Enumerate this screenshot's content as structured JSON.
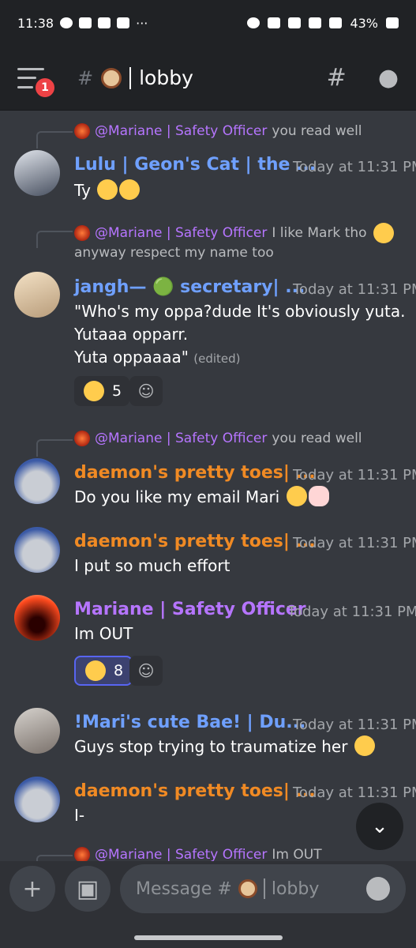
{
  "statusbar": {
    "time": "11:38",
    "dots": "···",
    "battery": "43%"
  },
  "header": {
    "badge": "1",
    "channel": "lobby"
  },
  "messages": [
    {
      "reply_name": "@Mariane | Safety Officer",
      "reply_text": "you read well",
      "author": "Lulu | Geon's Cat | the ...",
      "time": "Today at 11:31 PM",
      "text": "Ty"
    },
    {
      "reply_name": "@Mariane | Safety Officer",
      "reply_text": "I like Mark tho",
      "reply_text2": "anyway respect my name too",
      "author": "jangh— 🟢 secretary| ...",
      "time": "Today at 11:31 PM",
      "text": "\"Who's my oppa?dude It's obviously yuta.\nYutaaa opparr.\nYuta oppaaaa\"",
      "edited": "(edited)",
      "reaction_count": "5"
    },
    {
      "reply_name": "@Mariane | Safety Officer",
      "reply_text": "you read well",
      "author": "daemon's pretty toes| ...",
      "time": "Today at 11:31 PM",
      "text": "Do you like my email Mari"
    },
    {
      "author": "daemon's pretty toes| ...",
      "time": "Today at 11:31 PM",
      "text": "I put so much effort"
    },
    {
      "author": "Mariane | Safety Officer",
      "time": "Today at 11:31 PM",
      "text": "Im OUT",
      "reaction_count": "8"
    },
    {
      "author": "!Mari's cute Bae! | Du...",
      "time": "Today at 11:31 PM",
      "text": "Guys stop trying to traumatize her"
    },
    {
      "author": "daemon's pretty toes| ...",
      "time": "Today at 11:31 PM",
      "text": "I-"
    },
    {
      "reply_name": "@Mariane | Safety Officer",
      "reply_text": "Im OUT"
    }
  ],
  "composer": {
    "placeholder_prefix": "Message #",
    "placeholder_channel": "lobby"
  },
  "colors": {
    "bg": "#36393f",
    "header": "#202225",
    "blue_name": "#6fa0ff",
    "orange_name": "#f08a24",
    "purple_name": "#b675ff"
  }
}
